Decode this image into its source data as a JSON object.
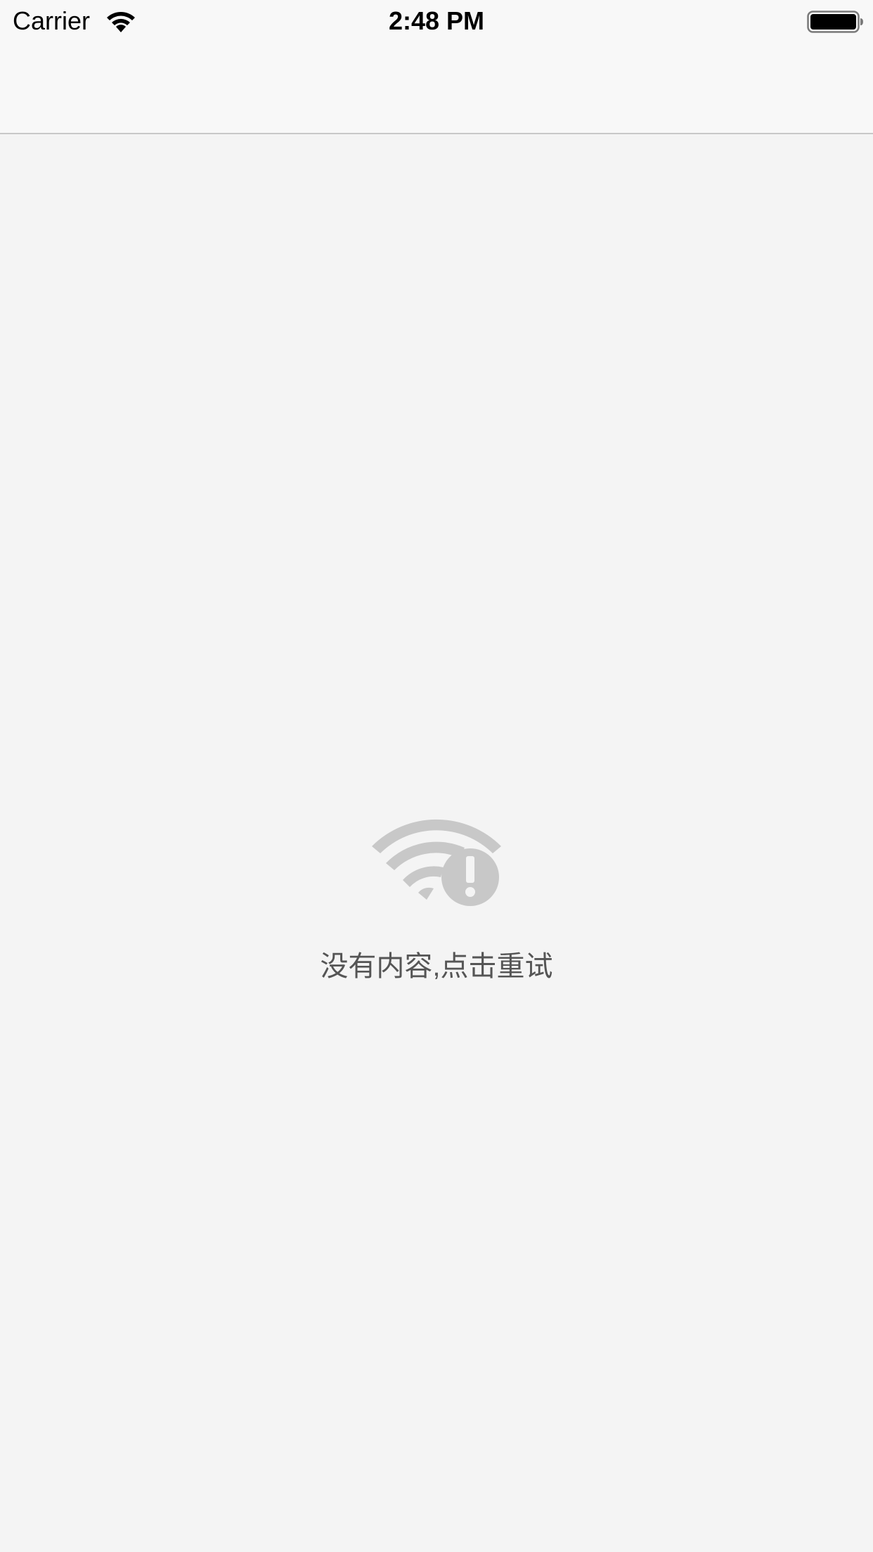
{
  "status_bar": {
    "carrier": "Carrier",
    "time": "2:48 PM",
    "wifi_icon": "wifi-icon",
    "battery_icon": "battery-icon"
  },
  "nav_bar": {
    "title": ""
  },
  "empty_state": {
    "icon": "wifi-warning-icon",
    "message": "没有内容,点击重试",
    "icon_color": "#c8c8c8",
    "text_color": "#555555"
  },
  "colors": {
    "background": "#f4f4f4",
    "nav_background": "#f8f8f8",
    "nav_border": "#c8c8c8"
  }
}
